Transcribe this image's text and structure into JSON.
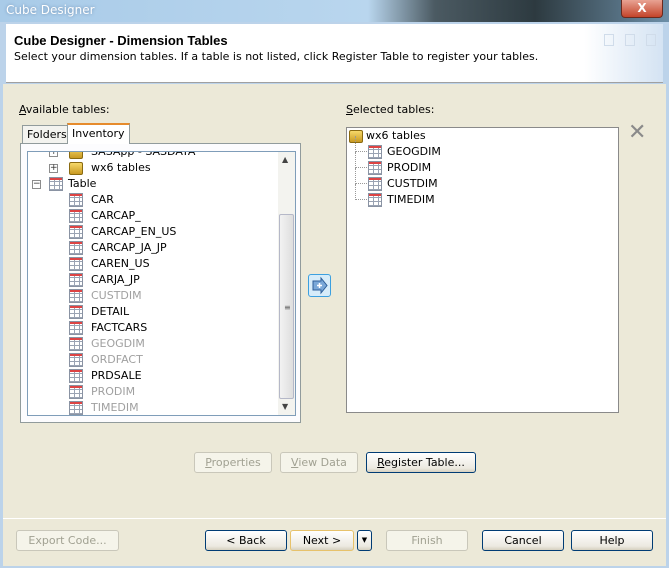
{
  "window": {
    "title": "Cube Designer",
    "close_label": "X"
  },
  "header": {
    "title": "Cube Designer - Dimension Tables",
    "subtitle": "Select your dimension tables. If a table is not listed, click Register Table to register your tables."
  },
  "available": {
    "label_accel": "A",
    "label_rest": "vailable tables:",
    "tabs": [
      {
        "label": "Folders",
        "active": false
      },
      {
        "label": "Inventory",
        "active": true
      }
    ],
    "partial_item": "SASApp - SASDATA",
    "library": "wx6 tables",
    "group": "Table",
    "tables": [
      {
        "name": "CAR",
        "disabled": false
      },
      {
        "name": "CARCAP_",
        "disabled": false
      },
      {
        "name": "CARCAP_EN_US",
        "disabled": false
      },
      {
        "name": "CARCAP_JA_JP",
        "disabled": false
      },
      {
        "name": "CAREN_US",
        "disabled": false
      },
      {
        "name": "CARJA_JP",
        "disabled": false
      },
      {
        "name": "CUSTDIM",
        "disabled": true
      },
      {
        "name": "DETAIL",
        "disabled": false
      },
      {
        "name": "FACTCARS",
        "disabled": false
      },
      {
        "name": "GEOGDIM",
        "disabled": true
      },
      {
        "name": "ORDFACT",
        "disabled": true
      },
      {
        "name": "PRDSALE",
        "disabled": false
      },
      {
        "name": "PRODIM",
        "disabled": true
      },
      {
        "name": "TIMEDIM",
        "disabled": true
      }
    ]
  },
  "selected": {
    "label_accel": "S",
    "label_rest": "elected tables:",
    "library": "wx6 tables",
    "tables": [
      "GEOGDIM",
      "PRODIM",
      "CUSTDIM",
      "TIMEDIM"
    ]
  },
  "actions": {
    "properties_accel": "P",
    "properties_rest": "roperties",
    "view_accel": "V",
    "view_rest": "iew Data",
    "register_accel": "R",
    "register_rest": "egister Table..."
  },
  "footer": {
    "export": "Export Code...",
    "back": "< Back",
    "next": "Next >",
    "finish": "Finish",
    "cancel": "Cancel",
    "help": "Help"
  }
}
